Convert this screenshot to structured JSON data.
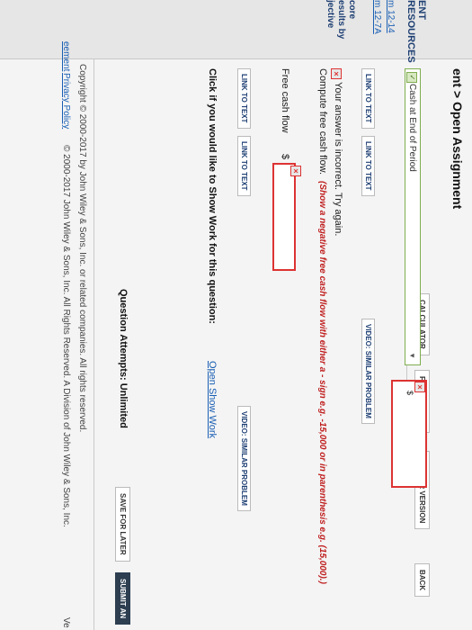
{
  "breadcrumb": {
    "prefix": "ent",
    "sep": ">",
    "current": "Open Assignment"
  },
  "sidebar": {
    "title": "ENT RESOURCES",
    "links": [
      "m 12-14",
      "m 12-7A"
    ],
    "core": "core",
    "results": "esults by",
    "objective": "jective"
  },
  "toolbar": {
    "calculator": "CALCULATOR",
    "full_screen": "FULL SCREEN",
    "printer_version": "PRINTER VERSION",
    "back": "BACK"
  },
  "question": {
    "select_value": "Cash at End of Period",
    "link_to_text_1": "LINK TO TEXT",
    "link_to_text_2": "LINK TO TEXT",
    "video_similar_1": "VIDEO: SIMILAR PROBLEM",
    "incorrect_message": "Your answer is incorrect.  Try again.",
    "instruction": "Compute free cash flow.",
    "hint": "(Show a negative free cash flow with either a - sign e.g. -15,000 or in parenthesis e.g. (15,000).)",
    "fcf_label": "Free cash flow",
    "currency": "$",
    "fcf_value": "",
    "link_to_text_3": "LINK TO TEXT",
    "link_to_text_4": "LINK TO TEXT",
    "video_similar_2": "VIDEO: SIMILAR PROBLEM",
    "show_work_prompt": "Click if you would like to Show Work for this question:",
    "open_show_work": "Open Show Work",
    "attempts": "Question Attempts: Unlimited",
    "save_later": "SAVE FOR LATER",
    "submit": "SUBMIT AN"
  },
  "footer": {
    "copyright": "Copyright © 2000-2017 by John Wiley & Sons, Inc. or related companies. All rights reserved.",
    "agreement": "eement",
    "privacy": "Privacy Policy",
    "copyright2": "© 2000-2017 John Wiley & Sons, Inc. All Rights Reserved. A Division of John Wiley & Sons, Inc.",
    "version": "Ve"
  }
}
